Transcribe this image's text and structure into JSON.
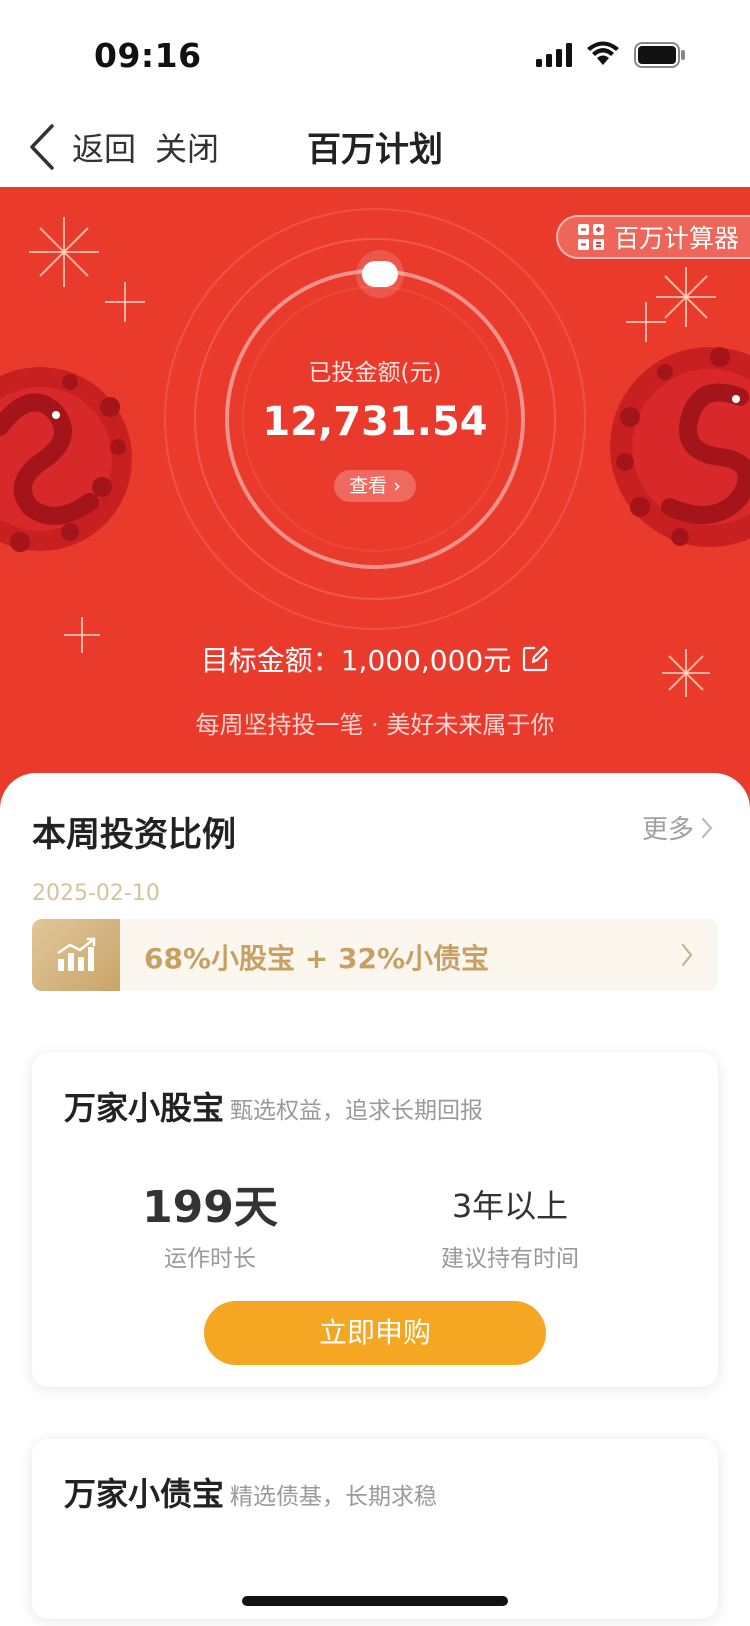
{
  "status_bar": {
    "time": "09:16"
  },
  "nav": {
    "back_label": "返回",
    "close_label": "关闭",
    "title": "百万计划"
  },
  "hero": {
    "calculator_label": "百万计算器",
    "invested_label": "已投金额(元)",
    "invested_value": "12,731.54",
    "view_label": "查看 ›",
    "target_label": "目标金额：1,000,000元",
    "tagline": "每周坚持投一笔 · 美好未来属于你",
    "progress_fraction": 0.0127,
    "background_color": "#ea3a2c"
  },
  "weekly": {
    "title": "本周投资比例",
    "more_label": "更多",
    "date": "2025-02-10",
    "ratio_text": "68%小股宝 + 32%小债宝",
    "ratio_icon": "chart-trend-icon"
  },
  "funds": [
    {
      "name": "万家小股宝",
      "description": "甄选权益，追求长期回报",
      "stat1_value": "199天",
      "stat1_label": "运作时长",
      "stat2_value": "3年以上",
      "stat2_label": "建议持有时间",
      "button_label": "立即申购"
    },
    {
      "name": "万家小债宝",
      "description": "精选债基，长期求稳"
    }
  ],
  "colors": {
    "accent_orange": "#f5a623",
    "gold_text": "#c7a064"
  }
}
